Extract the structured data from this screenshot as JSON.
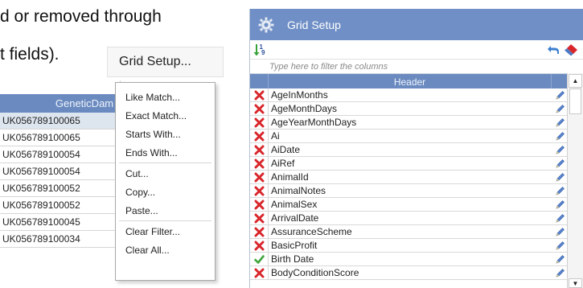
{
  "doc": {
    "line1": "d or removed through",
    "line2": "t fields)."
  },
  "grid_setup_button": {
    "label": "Grid Setup..."
  },
  "mini_grid": {
    "header": "GeneticDam",
    "rows": [
      "UK056789100065",
      "UK056789100065",
      "UK056789100054",
      "UK056789100054",
      "UK056789100052",
      "UK056789100052",
      "UK056789100045",
      "UK056789100034"
    ]
  },
  "context_menu": {
    "items": [
      "Like Match...",
      "Exact Match...",
      "Starts With...",
      "Ends With...",
      "Cut...",
      "Copy...",
      "Paste...",
      "Clear Filter...",
      "Clear All..."
    ]
  },
  "panel": {
    "title": "Grid Setup",
    "filter_placeholder": "Type here to filter the columns",
    "column_header": "Header",
    "rows": [
      {
        "name": "AgeInMonths",
        "state": "remove"
      },
      {
        "name": "AgeMonthDays",
        "state": "remove"
      },
      {
        "name": "AgeYearMonthDays",
        "state": "remove"
      },
      {
        "name": "Ai",
        "state": "remove"
      },
      {
        "name": "AiDate",
        "state": "remove"
      },
      {
        "name": "AiRef",
        "state": "remove"
      },
      {
        "name": "AnimalId",
        "state": "remove"
      },
      {
        "name": "AnimalNotes",
        "state": "remove"
      },
      {
        "name": "AnimalSex",
        "state": "remove"
      },
      {
        "name": "ArrivalDate",
        "state": "remove"
      },
      {
        "name": "AssuranceScheme",
        "state": "remove"
      },
      {
        "name": "BasicProfit",
        "state": "remove"
      },
      {
        "name": "Birth Date",
        "state": "check"
      },
      {
        "name": "BodyConditionScore",
        "state": "remove"
      }
    ]
  },
  "colors": {
    "header_blue": "#6b8bc0",
    "title_blue": "#6f8fc6",
    "remove_red": "#d8262b",
    "check_green": "#3fa43c"
  },
  "icons": [
    "gear-icon",
    "sort-icon",
    "undo-icon",
    "eraser-icon",
    "remove-icon",
    "check-icon",
    "pencil-icon"
  ]
}
